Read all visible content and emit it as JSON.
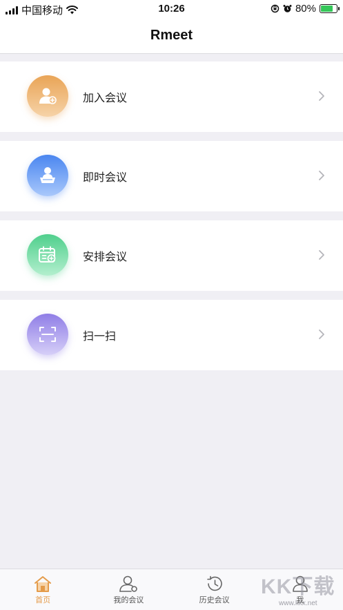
{
  "status_bar": {
    "carrier": "中国移动",
    "time": "10:26",
    "battery_percent": "80%",
    "battery_level": 0.8
  },
  "nav": {
    "title": "Rmeet"
  },
  "menu": {
    "items": [
      {
        "label": "加入会议",
        "icon": "join-meeting-icon",
        "color": "#e9a456"
      },
      {
        "label": "即时会议",
        "icon": "instant-meeting-icon",
        "color": "#4a86f0"
      },
      {
        "label": "安排会议",
        "icon": "schedule-meeting-icon",
        "color": "#4fcf8c"
      },
      {
        "label": "扫一扫",
        "icon": "scan-icon",
        "color": "#8f7de6"
      }
    ]
  },
  "tabs": [
    {
      "label": "首页",
      "icon": "home-icon",
      "active": true
    },
    {
      "label": "我的会议",
      "icon": "my-meetings-icon",
      "active": false
    },
    {
      "label": "历史会议",
      "icon": "history-icon",
      "active": false
    },
    {
      "label": "我",
      "icon": "profile-icon",
      "active": false
    }
  ],
  "watermark": {
    "text": "KK下载",
    "sub": "www.kkx.net"
  },
  "colors": {
    "accent": "#e49b4a",
    "background": "#f0eff4"
  }
}
